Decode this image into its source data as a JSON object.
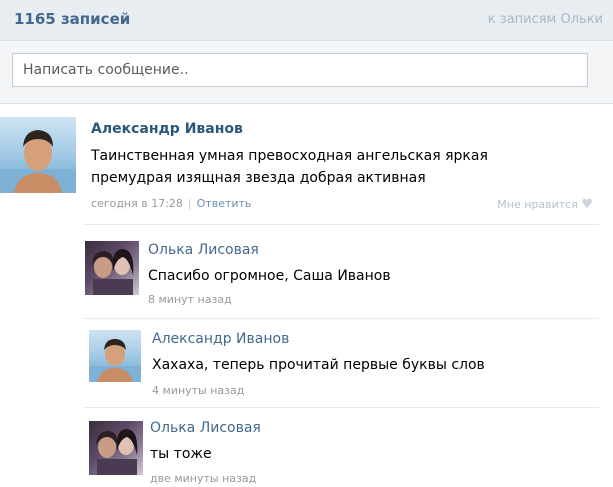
{
  "header": {
    "count": "1165 записей",
    "link": "к записям Ольки"
  },
  "compose": {
    "placeholder": "Написать сообщение.."
  },
  "post": {
    "author": "Александр Иванов",
    "text_line1": "Таинственная умная превосходная ангельская яркая",
    "text_line2": "премудрая изящная звезда добрая активная",
    "time": "сегодня в 17:28",
    "reply_label": "Ответить",
    "like_label": "Мне нравится"
  },
  "replies": [
    {
      "author": "Олька Лисовая",
      "text": "Спасибо огромное, Саша Иванов",
      "time": "8 минут назад"
    },
    {
      "author": "Александр Иванов",
      "text": "Хахаха, теперь прочитай первые буквы слов",
      "time": "4 минуты назад"
    },
    {
      "author": "Олька Лисовая",
      "text": "ты тоже",
      "time": "две минуты назад"
    }
  ]
}
